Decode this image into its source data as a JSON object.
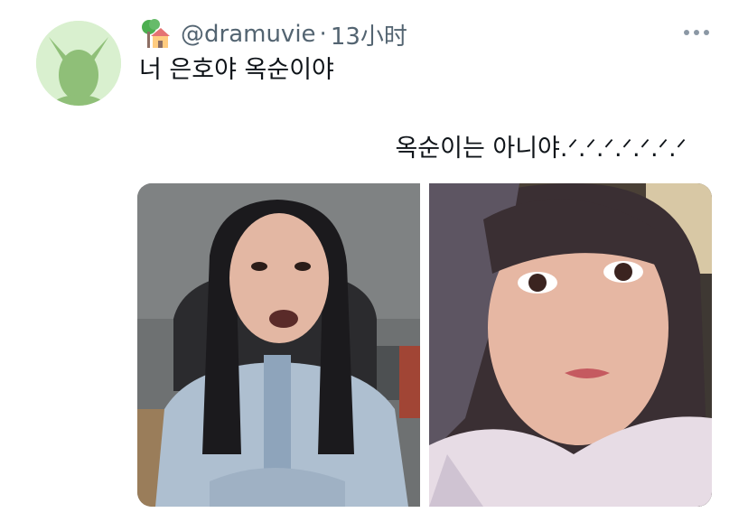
{
  "tweet": {
    "user_icon": "house-with-garden-icon",
    "handle": "@dramuvie",
    "separator": "·",
    "time": "13小时",
    "text_line1": "너 은호야 옥순이야",
    "text_line2": "옥순이는 아니야.ᐟ.ᐟ.ᐟ.ᐟ.ᐟ.ᐟ.ᐟ",
    "more_icon": "more-horizontal-icon"
  },
  "media": {
    "photos": [
      {
        "name": "photo-left",
        "description_icon": "person-photo"
      },
      {
        "name": "photo-right",
        "description_icon": "person-photo"
      }
    ]
  },
  "colors": {
    "text": "#0f1419",
    "secondary": "#536471",
    "avatar_bg": "#d9f0cf",
    "avatar_fg": "#8fbf78"
  }
}
